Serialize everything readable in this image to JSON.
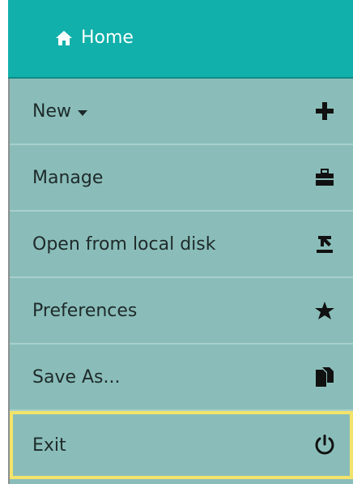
{
  "header": {
    "title": "Home",
    "icon": "home-icon",
    "bg_color": "#11b0aa"
  },
  "menu": {
    "items": [
      {
        "label": "New",
        "icon": "plus-icon",
        "has_dropdown": true
      },
      {
        "label": "Manage",
        "icon": "briefcase-icon"
      },
      {
        "label": "Open from local disk",
        "icon": "upload-icon"
      },
      {
        "label": "Preferences",
        "icon": "star-icon"
      },
      {
        "label": "Save As...",
        "icon": "copy-icon"
      },
      {
        "label": "Exit",
        "icon": "power-icon",
        "highlighted": true
      }
    ],
    "bg_color": "#8abdb9",
    "highlight_color": "#f4e36a"
  }
}
